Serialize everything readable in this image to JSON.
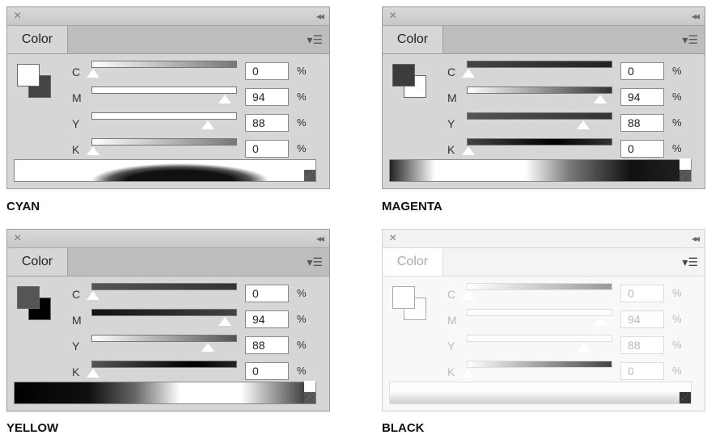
{
  "panels": [
    {
      "caption": "CYAN",
      "tab": "Color",
      "channels": [
        {
          "label": "C",
          "value": "0",
          "pct": "%"
        },
        {
          "label": "M",
          "value": "94",
          "pct": "%"
        },
        {
          "label": "Y",
          "value": "88",
          "pct": "%"
        },
        {
          "label": "K",
          "value": "0",
          "pct": "%"
        }
      ]
    },
    {
      "caption": "MAGENTA",
      "tab": "Color",
      "channels": [
        {
          "label": "C",
          "value": "0",
          "pct": "%"
        },
        {
          "label": "M",
          "value": "94",
          "pct": "%"
        },
        {
          "label": "Y",
          "value": "88",
          "pct": "%"
        },
        {
          "label": "K",
          "value": "0",
          "pct": "%"
        }
      ]
    },
    {
      "caption": "YELLOW",
      "tab": "Color",
      "channels": [
        {
          "label": "C",
          "value": "0",
          "pct": "%"
        },
        {
          "label": "M",
          "value": "94",
          "pct": "%"
        },
        {
          "label": "Y",
          "value": "88",
          "pct": "%"
        },
        {
          "label": "K",
          "value": "0",
          "pct": "%"
        }
      ]
    },
    {
      "caption": "BLACK",
      "tab": "Color",
      "channels": [
        {
          "label": "C",
          "value": "0",
          "pct": "%"
        },
        {
          "label": "M",
          "value": "94",
          "pct": "%"
        },
        {
          "label": "Y",
          "value": "88",
          "pct": "%"
        },
        {
          "label": "K",
          "value": "0",
          "pct": "%"
        }
      ]
    }
  ],
  "icons": {
    "close": "close-icon",
    "collapse": "collapse-icon",
    "menu": "panel-menu-icon"
  }
}
